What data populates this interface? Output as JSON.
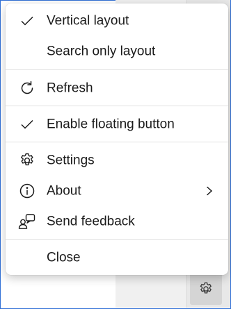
{
  "menu": {
    "items": [
      {
        "label": "Vertical layout",
        "checked": true,
        "icon": "checkmark-icon"
      },
      {
        "label": "Search only layout",
        "checked": false
      },
      {
        "label": "Refresh",
        "icon": "refresh-icon"
      },
      {
        "label": "Enable floating button",
        "checked": true,
        "icon": "checkmark-icon"
      },
      {
        "label": "Settings",
        "icon": "gear-icon"
      },
      {
        "label": "About",
        "icon": "info-icon",
        "submenu": true
      },
      {
        "label": "Send feedback",
        "icon": "feedback-icon"
      },
      {
        "label": "Close"
      }
    ]
  },
  "colors": {
    "accent_border": "#2f6fd6",
    "menu_bg": "#ffffff",
    "text": "#1a1a1a"
  }
}
